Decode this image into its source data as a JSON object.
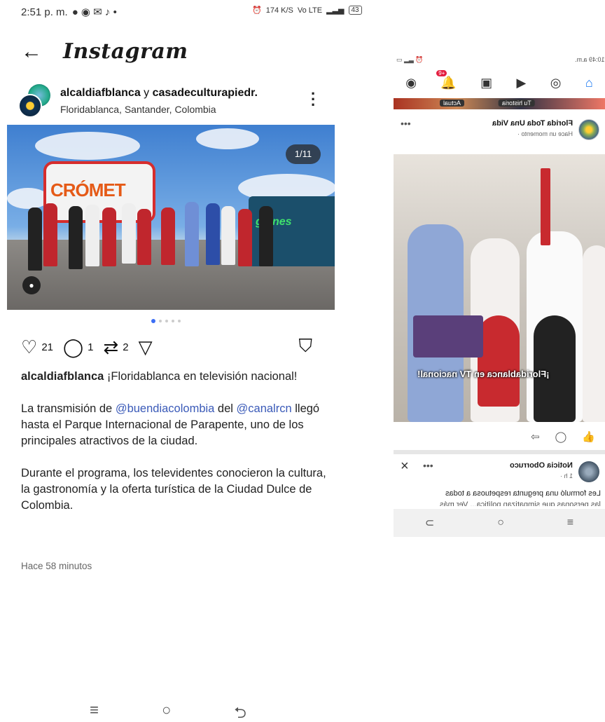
{
  "left_phone": {
    "status_bar": {
      "time": "2:51 p. m.",
      "network_right": "174 K/S",
      "lte": "Vo LTE",
      "battery": "43"
    },
    "header": {
      "title": "Instagram"
    },
    "post": {
      "user_primary": "alcaldiafblanca",
      "joiner": " y ",
      "user_secondary": "casadeculturapiedr.",
      "location": "Floridablanca, Santander, Colombia",
      "counter": "1/11",
      "likes": "21",
      "comments": "1",
      "reposts": "2"
    },
    "caption": {
      "author": "alcaldiafblanca",
      "p1_text": " ¡Floridablanca en televisión nacional!",
      "p2_pre": "La transmisión de ",
      "p2_mention1": "@buendiacolombia",
      "p2_mid": " del ",
      "p2_mention2": "@canalrcn",
      "p2_post": " llegó hasta el Parque Internacional de Parapente, uno de los principales atractivos de la ciudad.",
      "p3": "Durante el programa, los televidentes conocieron la cultura, la gastronomía y la oferta turística de la Ciudad Dulce de Colombia."
    },
    "timestamp": "Hace 58 minutos",
    "photo_balloon_text": "CRÓMET",
    "photo_truck_text": "gíones",
    "icons": {
      "back": "arrow-left-icon",
      "more": "more-vertical-icon",
      "like": "heart-icon",
      "comment": "comment-icon",
      "repost": "repost-icon",
      "share": "send-icon",
      "save": "bookmark-icon"
    },
    "nav": {
      "menu": "≡",
      "home": "○",
      "back": "⮌"
    }
  },
  "right_phone": {
    "status_time": "10:49 a.m.",
    "notif_badge": "9+",
    "story1": "Tu historia",
    "story2": "Actual",
    "post1": {
      "name": "Florida Toda Una Vida",
      "time": "Hace un momento ·",
      "subtitle": "¡Floridablanca en TV nacional!"
    },
    "post2": {
      "name": "Noticia Oborruco",
      "time": "1 h ·",
      "text": "Les formuló una pregunta respetuosa a todas",
      "text2": "las personas que simpatizan política... Ver más"
    }
  },
  "colors": {
    "accent_blue": "#3b6ef5",
    "mention": "#3a5ab8",
    "fb_blue": "#1877f2"
  }
}
